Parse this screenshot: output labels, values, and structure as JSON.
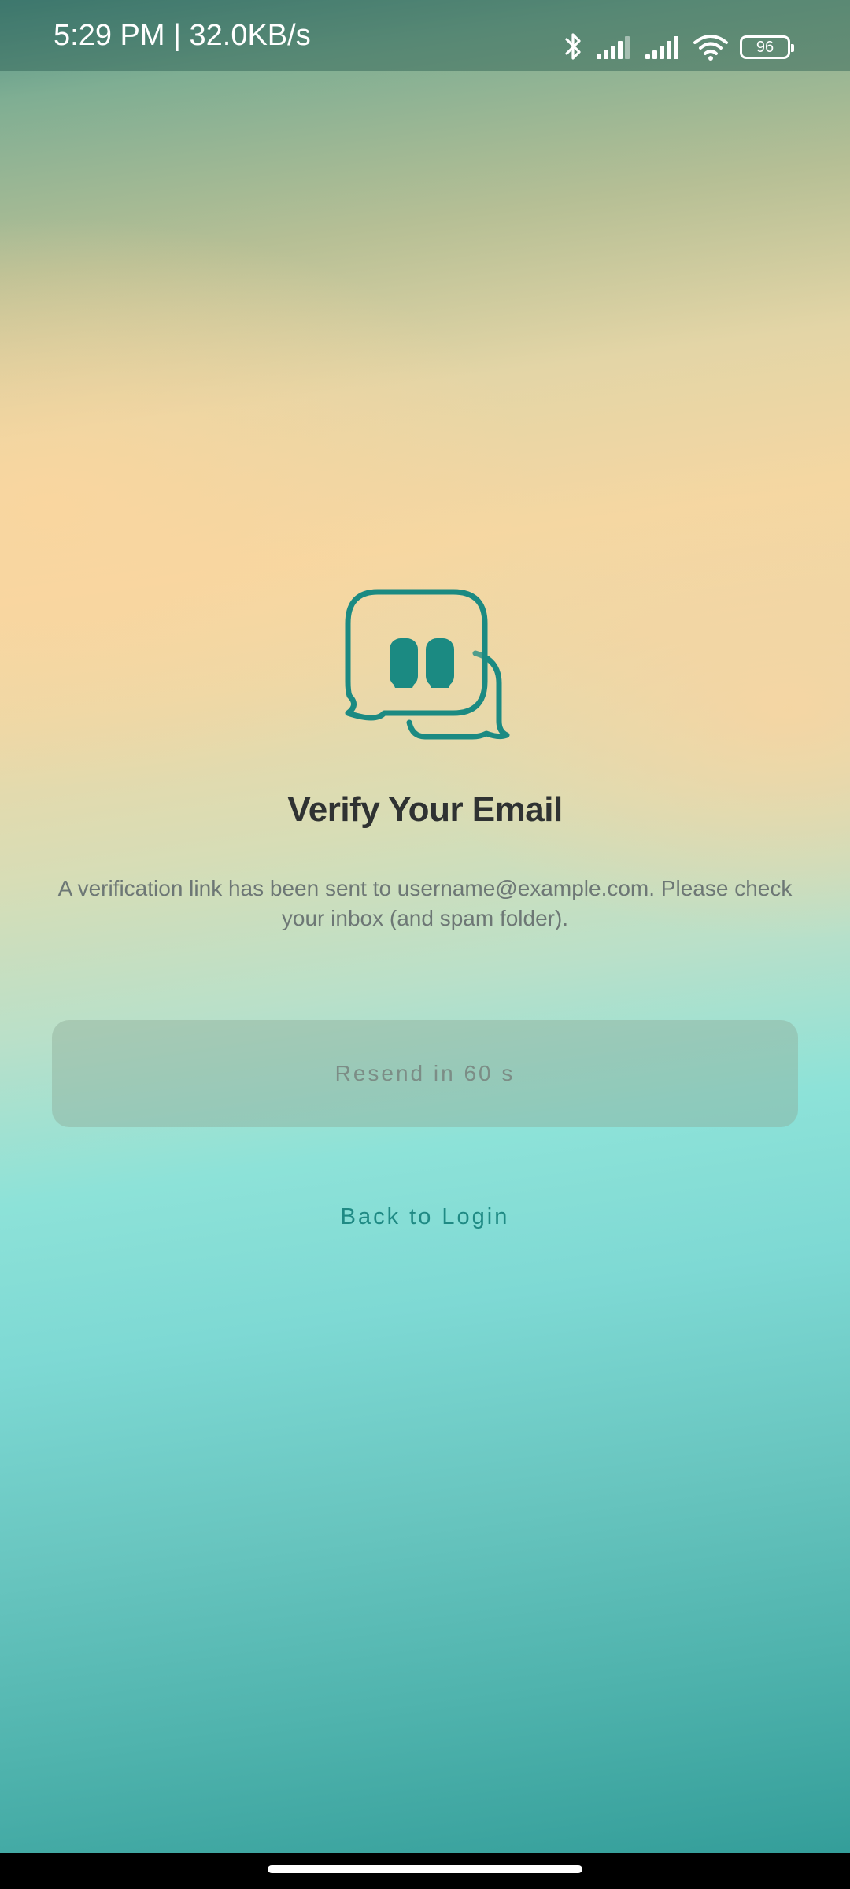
{
  "status_bar": {
    "time_speed": "5:29 PM | 32.0KB/s",
    "battery_level": "96",
    "icons": [
      "bluetooth-icon",
      "signal-icon",
      "signal-icon",
      "wifi-icon",
      "battery-icon"
    ]
  },
  "main": {
    "icon": "chat-bubbles-icon",
    "title": "Verify Your Email",
    "description": "A verification link has been sent to username@example.com. Please check your inbox (and spam folder).",
    "resend_label": "Resend in 60 s",
    "back_label": "Back to Login"
  },
  "colors": {
    "accent": "#1b8a82",
    "title": "#2f3232",
    "body_text": "#6d7775",
    "disabled_button": "#a9c2ae"
  }
}
